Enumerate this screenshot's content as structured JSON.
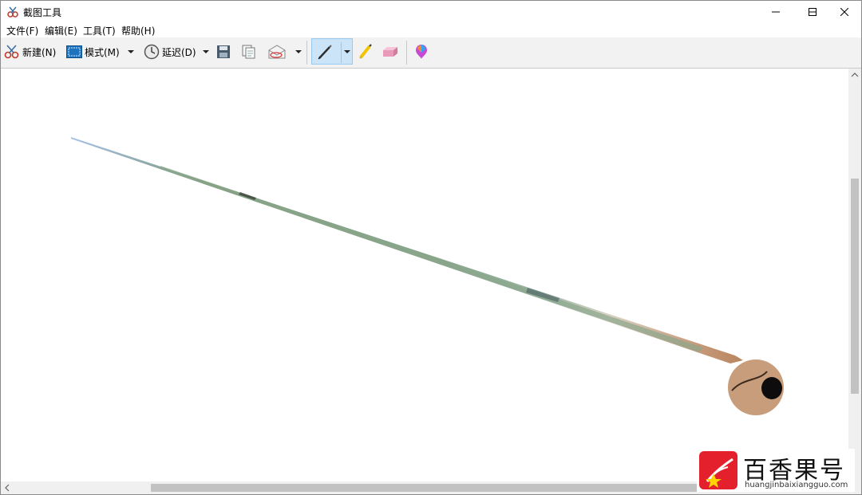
{
  "window": {
    "title": "截图工具"
  },
  "menubar": {
    "items": [
      {
        "label": "文件(F)"
      },
      {
        "label": "编辑(E)"
      },
      {
        "label": "工具(T)"
      },
      {
        "label": "帮助(H)"
      }
    ]
  },
  "toolbar": {
    "new_label": "新建(N)",
    "mode_label": "模式(M)",
    "delay_label": "延迟(D)",
    "icons": [
      "save-icon",
      "copy-icon",
      "send-email-icon",
      "pen-icon",
      "highlighter-icon",
      "eraser-icon",
      "paint3d-icon"
    ],
    "active_tool": "pen"
  },
  "watermark": {
    "name": "百香果号",
    "url": "huangjinbaixiangguo.com",
    "accent": "#e5202d"
  },
  "colors": {
    "toolbar_bg": "#f2f2f2",
    "active_tool_bg": "#cce4f7",
    "stroke": "#8fa88a"
  }
}
